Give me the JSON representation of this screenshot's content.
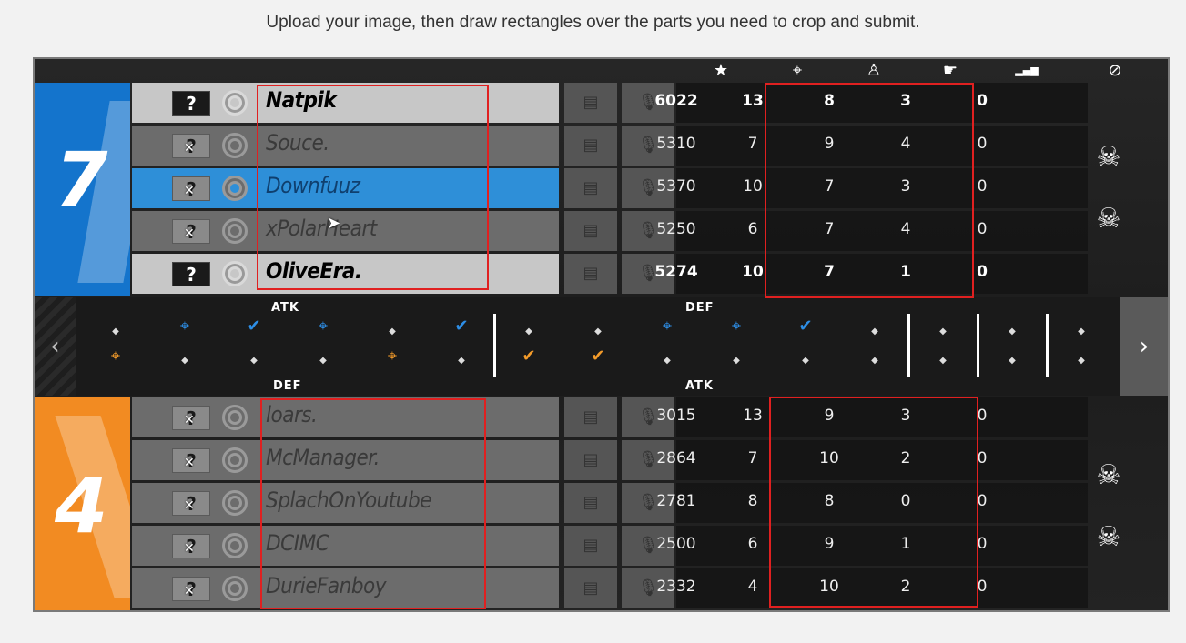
{
  "instruction": "Upload your image, then draw rectangles over the parts you need to crop and submit.",
  "header_icons": [
    {
      "name": "score-icon",
      "glyph": "★"
    },
    {
      "name": "kills-icon",
      "glyph": "⌖"
    },
    {
      "name": "assists-icon",
      "glyph": "♙"
    },
    {
      "name": "deaths-icon",
      "glyph": "☛"
    },
    {
      "name": "ping-icon",
      "glyph": "▂▄▆"
    },
    {
      "name": "banned-icon",
      "glyph": "⊘"
    }
  ],
  "team_blue": {
    "number": "7",
    "color": "#1474cc",
    "players": [
      {
        "name": "Natpik",
        "score": "6022",
        "kills": "13",
        "assists": "8",
        "deaths": "3",
        "ping": "0",
        "state": "active"
      },
      {
        "name": "Souce.",
        "score": "5310",
        "kills": "7",
        "assists": "9",
        "deaths": "4",
        "ping": "0",
        "state": "dead"
      },
      {
        "name": "Downfuuz",
        "score": "5370",
        "kills": "10",
        "assists": "7",
        "deaths": "3",
        "ping": "0",
        "state": "selected"
      },
      {
        "name": "xPolarHeart",
        "score": "5250",
        "kills": "6",
        "assists": "7",
        "deaths": "4",
        "ping": "0",
        "state": "dead"
      },
      {
        "name": "OliveEra.",
        "score": "5274",
        "kills": "10",
        "assists": "7",
        "deaths": "1",
        "ping": "0",
        "state": "active"
      }
    ]
  },
  "team_orange": {
    "number": "4",
    "color": "#f28b22",
    "players": [
      {
        "name": "loars.",
        "score": "3015",
        "kills": "13",
        "assists": "9",
        "deaths": "3",
        "ping": "0",
        "state": "dead"
      },
      {
        "name": "McManager.",
        "score": "2864",
        "kills": "7",
        "assists": "10",
        "deaths": "2",
        "ping": "0",
        "state": "dead"
      },
      {
        "name": "SplachOnYoutube",
        "score": "2781",
        "kills": "8",
        "assists": "8",
        "deaths": "0",
        "ping": "0",
        "state": "dead"
      },
      {
        "name": "DCIMC",
        "score": "2500",
        "kills": "6",
        "assists": "9",
        "deaths": "1",
        "ping": "0",
        "state": "dead"
      },
      {
        "name": "DurieFanboy",
        "score": "2332",
        "kills": "4",
        "assists": "10",
        "deaths": "2",
        "ping": "0",
        "state": "dead"
      }
    ]
  },
  "rounds": {
    "label_top_left": "ATK",
    "label_top_right": "DEF",
    "label_bottom_left": "DEF",
    "label_bottom_right": "ATK",
    "prev": "‹",
    "next": "›"
  },
  "colors": {
    "crop_rect": "#e02020",
    "blue": "#2d8ee6",
    "orange": "#f39b2a"
  }
}
